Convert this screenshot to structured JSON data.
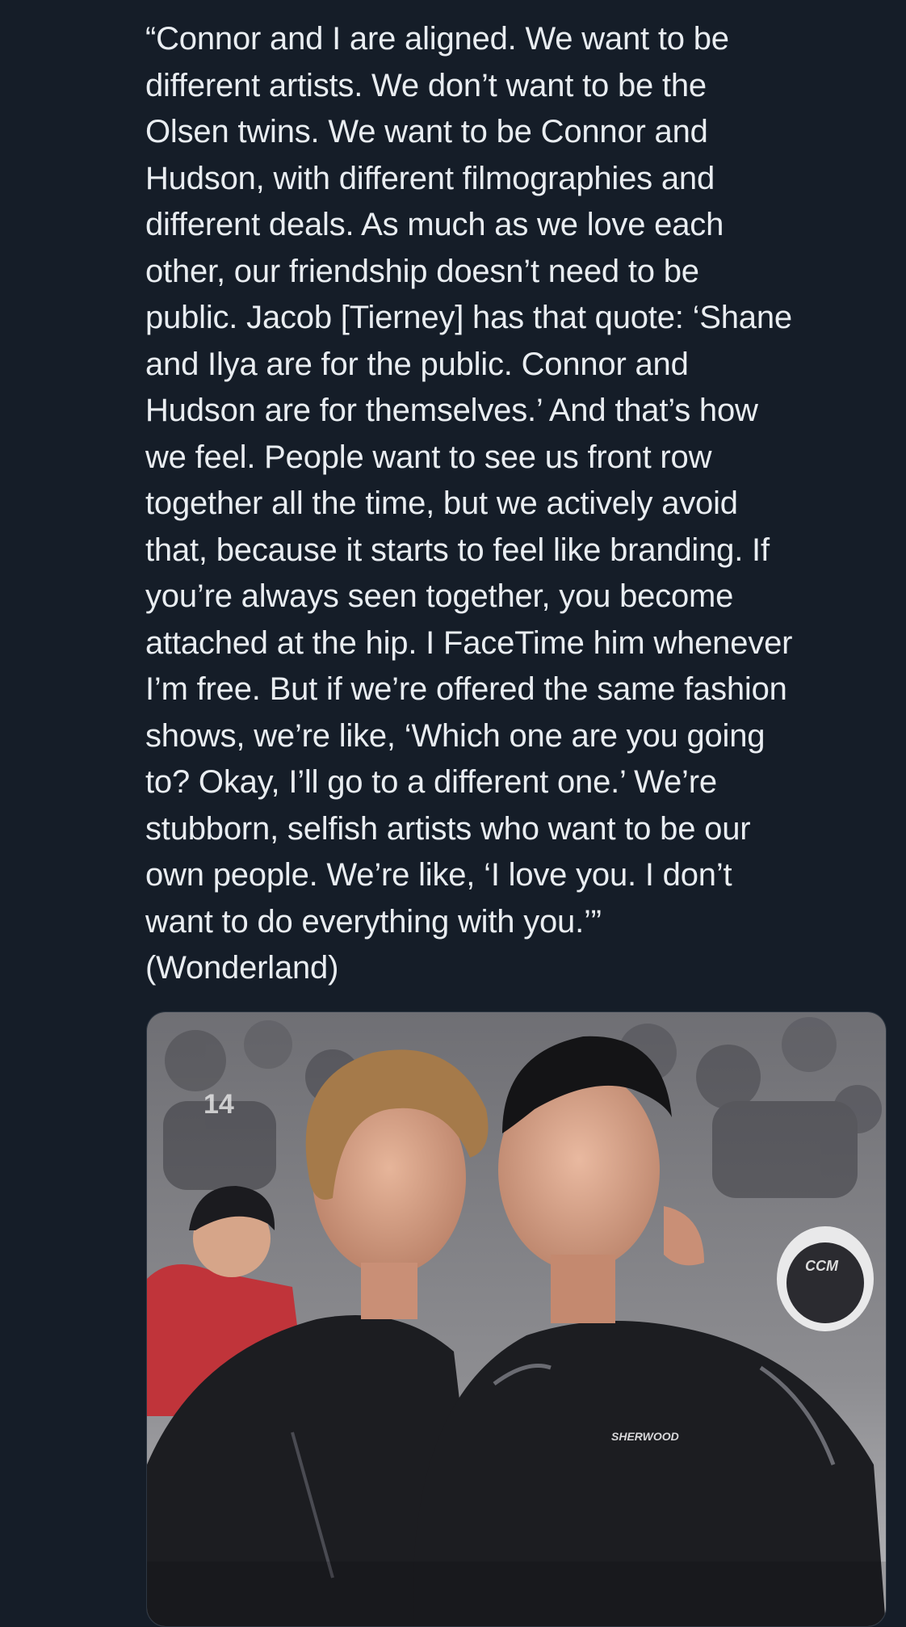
{
  "post": {
    "text": "“Connor and I are aligned. We want to be\ndifferent artists. We don’t want to be the\nOlsen twins. We want to be Connor and\nHudson, with different filmographies and\ndifferent deals. As much as we love each\nother, our friendship doesn’t need to be\npublic. Jacob [Tierney] has that quote: ‘Shane\nand Ilya are for the public. Connor and\nHudson are for themselves.’ And that’s how\nwe feel. People want to see us front row\ntogether all the time, but we actively avoid\nthat, because it starts to feel like branding. If\nyou’re always seen together, you become\nattached at the hip. I FaceTime him whenever\nI’m free. But if we’re offered the same fashion\nshows, we’re like, ‘Which one are you going\nto? Okay, I’ll go to a different one.’ We’re\nstubborn, selfish artists who want to be our\nown people. We’re like, ‘I love you. I don’t\nwant to do everything with you.’”\n(Wonderland)"
  },
  "media": {
    "shirt_logo": "SHERWOOD",
    "jersey_number": "14",
    "helmet_brand": "CCM"
  },
  "colors": {
    "background": "#151d28",
    "text": "#e9edf1",
    "shirt": "#1c1d21",
    "mural": "#8a8a8e",
    "jersey_red": "#c0343a"
  }
}
